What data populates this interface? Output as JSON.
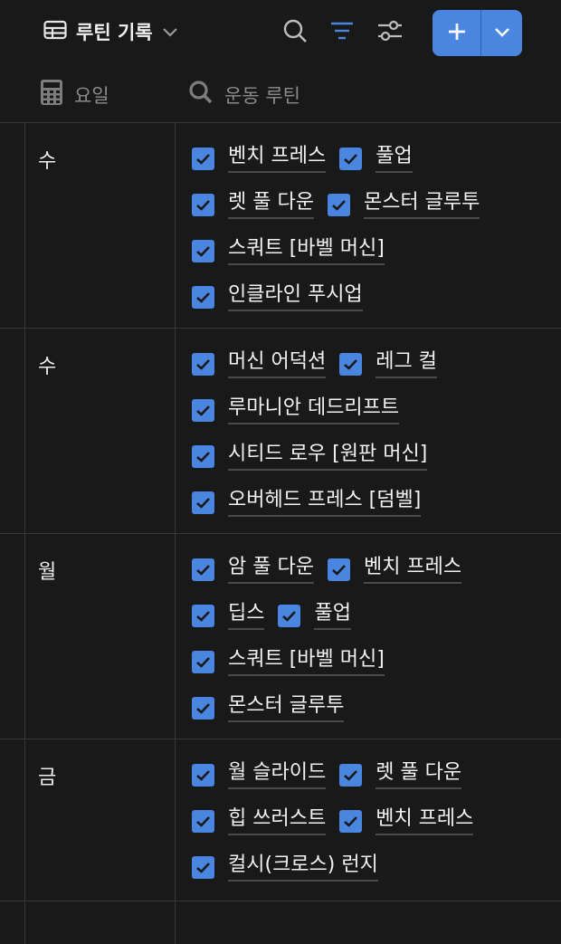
{
  "toolbar": {
    "view_label": "루틴 기록",
    "icons": [
      "table-icon",
      "chevron-down-icon",
      "search-icon",
      "filter-icon",
      "sliders-icon",
      "plus-icon",
      "chevron-down-icon"
    ],
    "accent_color": "#4a86e0"
  },
  "columns": [
    {
      "label": "요일",
      "icon": "calendar-icon"
    },
    {
      "label": "운동 루틴",
      "icon": "search-icon"
    }
  ],
  "rows": [
    {
      "day": "수",
      "lines": [
        [
          "벤치 프레스",
          "풀업"
        ],
        [
          "렛 풀 다운",
          "몬스터 글루투"
        ],
        [
          "스쿼트 [바벨 머신]"
        ],
        [
          "인클라인 푸시업"
        ]
      ]
    },
    {
      "day": "수",
      "lines": [
        [
          "머신 어덕션",
          "레그 컬"
        ],
        [
          "루마니안 데드리프트"
        ],
        [
          "시티드 로우 [원판 머신]"
        ],
        [
          "오버헤드 프레스 [덤벨]"
        ]
      ]
    },
    {
      "day": "월",
      "lines": [
        [
          "암 풀 다운",
          "벤치 프레스"
        ],
        [
          "딥스",
          "풀업"
        ],
        [
          "스쿼트 [바벨 머신]"
        ],
        [
          "몬스터 글루투"
        ]
      ]
    },
    {
      "day": "금",
      "lines": [
        [
          "월 슬라이드",
          "렛 풀 다운"
        ],
        [
          "힙 쓰러스트",
          "벤치 프레스"
        ],
        [
          "컬시(크로스) 런지"
        ]
      ]
    }
  ]
}
